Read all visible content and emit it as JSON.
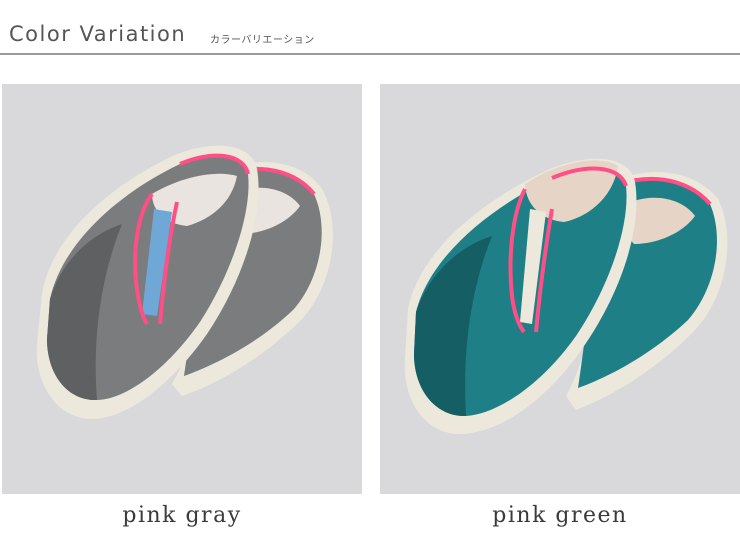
{
  "header": {
    "title": "Color Variation",
    "subtitle": "カラーバリエーション"
  },
  "products": [
    {
      "caption": "pink gray",
      "upper_color": "#7b7c7e",
      "upper_shade": "#5f6062",
      "trim_color": "#ff4f86",
      "sole_color": "#ece8dc",
      "insole_color": "#e9e4df",
      "gusset_color": "#6fa7d6"
    },
    {
      "caption": "pink green",
      "upper_color": "#1f7f86",
      "upper_shade": "#145e64",
      "trim_color": "#ff4f86",
      "sole_color": "#ece8dc",
      "insole_color": "#e6d5c6",
      "gusset_color": "#ece8dc"
    }
  ],
  "colors": {
    "photo_background": "#d9d9db",
    "header_text": "#555555",
    "rule": "#9a9a9a"
  }
}
